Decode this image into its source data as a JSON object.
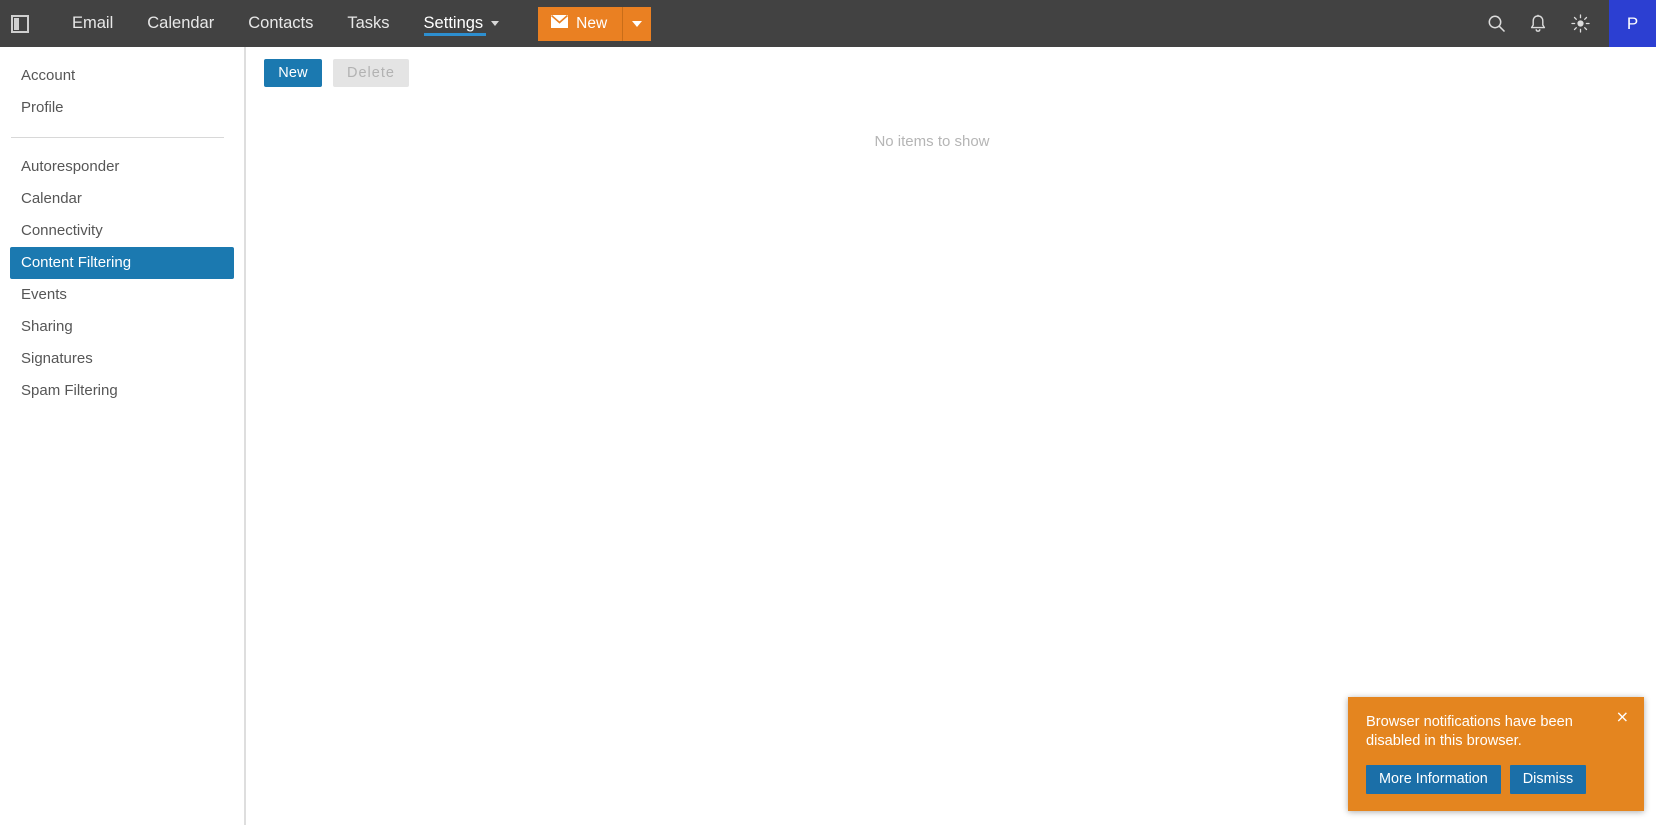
{
  "header": {
    "panel_toggle_icon": "sidebar-panel-icon",
    "nav": [
      {
        "label": "Email",
        "active": false,
        "has_caret": false
      },
      {
        "label": "Calendar",
        "active": false,
        "has_caret": false
      },
      {
        "label": "Contacts",
        "active": false,
        "has_caret": false
      },
      {
        "label": "Tasks",
        "active": false,
        "has_caret": false
      },
      {
        "label": "Settings",
        "active": true,
        "has_caret": true
      }
    ],
    "compose": {
      "label": "New",
      "icon": "envelope-icon",
      "dropdown_icon": "caret-down-icon",
      "background": "#ea8022"
    },
    "actions": [
      {
        "name": "search-icon",
        "label": "Search"
      },
      {
        "name": "notifications-bell-icon",
        "label": "Notifications"
      },
      {
        "name": "brightness-sun-icon",
        "label": "Theme"
      }
    ],
    "avatar": {
      "initial": "P",
      "background": "#2c3fd2"
    },
    "background": "#424242",
    "active_underline_color": "#2d8fd0"
  },
  "sidebar": {
    "group_one": [
      {
        "label": "Account",
        "selected": false
      },
      {
        "label": "Profile",
        "selected": false
      }
    ],
    "group_two": [
      {
        "label": "Autoresponder",
        "selected": false
      },
      {
        "label": "Calendar",
        "selected": false
      },
      {
        "label": "Connectivity",
        "selected": false
      },
      {
        "label": "Content Filtering",
        "selected": true
      },
      {
        "label": "Events",
        "selected": false
      },
      {
        "label": "Sharing",
        "selected": false
      },
      {
        "label": "Signatures",
        "selected": false
      },
      {
        "label": "Spam Filtering",
        "selected": false
      }
    ],
    "selected_background": "#1b79b0"
  },
  "main": {
    "toolbar": {
      "new_label": "New",
      "delete_label": "Delete",
      "delete_disabled": true
    },
    "empty_message": "No items to show"
  },
  "toast": {
    "message": "Browser notifications have been disabled in this browser.",
    "close_icon": "×",
    "more_info_label": "More Information",
    "dismiss_label": "Dismiss",
    "background": "#e4851f",
    "button_color": "#1b6fa8"
  }
}
